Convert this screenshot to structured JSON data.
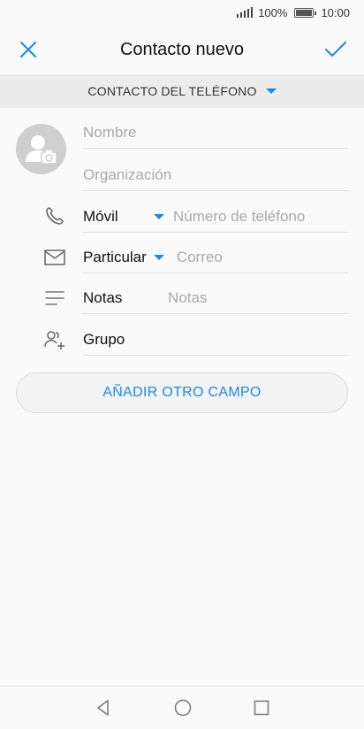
{
  "status_bar": {
    "battery_percent": "100%",
    "time": "10:00"
  },
  "header": {
    "title": "Contacto nuevo",
    "close_icon": "close-icon",
    "confirm_icon": "check-icon"
  },
  "account": {
    "label": "CONTACTO DEL TELÉFONO"
  },
  "form": {
    "name_placeholder": "Nombre",
    "organization_placeholder": "Organización",
    "phone": {
      "type": "Móvil",
      "placeholder": "Número de teléfono"
    },
    "email": {
      "type": "Particular",
      "placeholder": "Correo"
    },
    "notes": {
      "label": "Notas",
      "placeholder": "Notas"
    },
    "group": {
      "label": "Grupo"
    }
  },
  "add_field_label": "AÑADIR OTRO CAMPO",
  "colors": {
    "accent": "#1a8ae6",
    "avatar_bg": "#cfcfcf"
  }
}
